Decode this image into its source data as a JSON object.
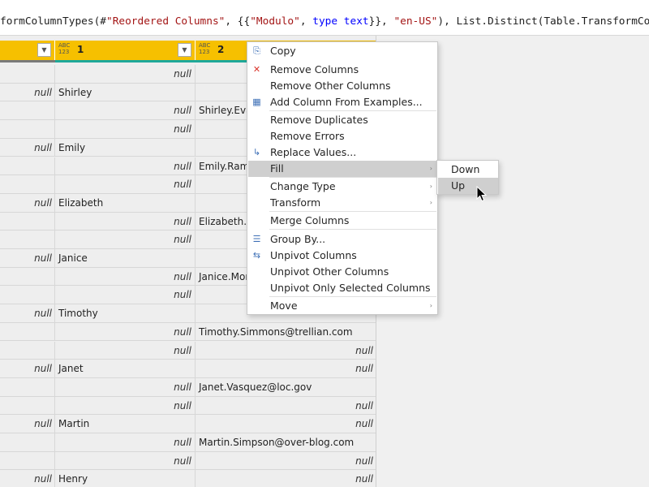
{
  "formula_bar": {
    "part1": "formColumnTypes(#",
    "str1": "\"Reordered Columns\"",
    "part2": ", {{",
    "str2": "\"Modulo\"",
    "part3": ", ",
    "kw1": "type text",
    "part4": "}}, ",
    "str3": "\"en-US\"",
    "part5": "), List.Distinct(Table.TransformColumnType"
  },
  "columns": [
    {
      "name": "",
      "type_icon": "ABC 123",
      "quality_color": "#7a7a7a"
    },
    {
      "name": "1",
      "type_icon": "ABC 123",
      "quality_color": "#1fa89a"
    },
    {
      "name": "2",
      "type_icon": "ABC 123",
      "quality_color": "#1fa89a"
    }
  ],
  "rows": [
    [
      "",
      "null",
      ""
    ],
    [
      "null",
      "Shirley",
      ""
    ],
    [
      "",
      "null",
      "Shirley.Eva"
    ],
    [
      "",
      "null",
      ""
    ],
    [
      "null",
      "Emily",
      ""
    ],
    [
      "",
      "null",
      "Emily.Ramo"
    ],
    [
      "",
      "null",
      ""
    ],
    [
      "null",
      "Elizabeth",
      ""
    ],
    [
      "",
      "null",
      "Elizabeth.M"
    ],
    [
      "",
      "null",
      ""
    ],
    [
      "null",
      "Janice",
      ""
    ],
    [
      "",
      "null",
      "Janice.Mor"
    ],
    [
      "",
      "null",
      ""
    ],
    [
      "null",
      "Timothy",
      ""
    ],
    [
      "",
      "null",
      "Timothy.Simmons@trellian.com"
    ],
    [
      "",
      "null",
      "null"
    ],
    [
      "null",
      "Janet",
      "null"
    ],
    [
      "",
      "null",
      "Janet.Vasquez@loc.gov"
    ],
    [
      "",
      "null",
      "null"
    ],
    [
      "null",
      "Martin",
      "null"
    ],
    [
      "",
      "null",
      "Martin.Simpson@over-blog.com"
    ],
    [
      "",
      "null",
      "null"
    ],
    [
      "null",
      "Henry",
      "null"
    ]
  ],
  "context_menu": {
    "items": [
      {
        "label": "Copy",
        "icon": "copy-icon",
        "glyph": "⎘"
      },
      {
        "label": "Remove Columns",
        "icon": "remove-columns-icon",
        "glyph": "✕"
      },
      {
        "label": "Remove Other Columns",
        "icon": "",
        "glyph": ""
      },
      {
        "label": "Add Column From Examples...",
        "icon": "add-column-examples-icon",
        "glyph": "▦"
      },
      {
        "label": "Remove Duplicates",
        "icon": "",
        "glyph": ""
      },
      {
        "label": "Remove Errors",
        "icon": "",
        "glyph": ""
      },
      {
        "label": "Replace Values...",
        "icon": "replace-values-icon",
        "glyph": "↳"
      },
      {
        "label": "Fill",
        "icon": "",
        "glyph": "",
        "submenu": true
      },
      {
        "label": "Change Type",
        "icon": "",
        "glyph": "",
        "submenu": true
      },
      {
        "label": "Transform",
        "icon": "",
        "glyph": "",
        "submenu": true
      },
      {
        "label": "Merge Columns",
        "icon": "",
        "glyph": ""
      },
      {
        "label": "Group By...",
        "icon": "group-by-icon",
        "glyph": "☰"
      },
      {
        "label": "Unpivot Columns",
        "icon": "unpivot-columns-icon",
        "glyph": "⇆"
      },
      {
        "label": "Unpivot Other Columns",
        "icon": "",
        "glyph": ""
      },
      {
        "label": "Unpivot Only Selected Columns",
        "icon": "",
        "glyph": ""
      },
      {
        "label": "Move",
        "icon": "",
        "glyph": "",
        "submenu": true
      }
    ],
    "submenu_arrow": "›"
  },
  "fill_submenu": {
    "items": [
      {
        "label": "Down"
      },
      {
        "label": "Up"
      }
    ]
  },
  "colors": {
    "header_bg": "#f6c000",
    "quality_teal": "#1fa89a",
    "menu_highlight": "#cfcfcf"
  }
}
